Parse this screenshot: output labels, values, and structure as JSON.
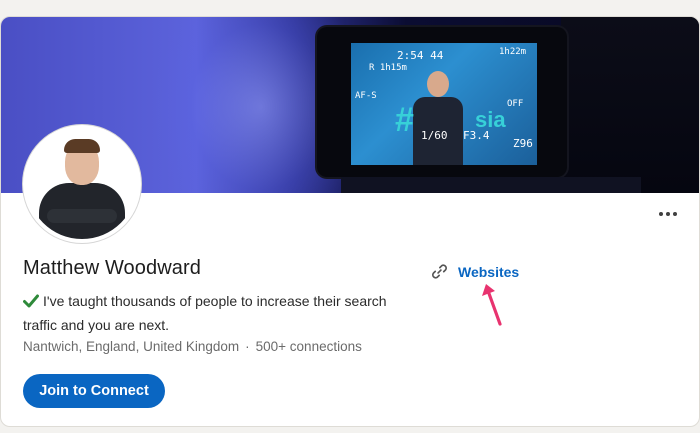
{
  "banner": {
    "hud": {
      "time": "2:54 44",
      "record_readout": "R 1h15m",
      "battery": "1h22m",
      "shutter": "1/60",
      "aperture": "F3.4",
      "iso": "Z96",
      "af_mode": "AF-S",
      "wb_off": "OFF"
    },
    "screen_text": {
      "hash": "#",
      "sia": "sia"
    }
  },
  "profile": {
    "name": "Matthew Woodward",
    "headline": "I've taught thousands of people to increase their search traffic and you are next.",
    "location": "Nantwich, England, United Kingdom",
    "separator": "·",
    "connections": "500+ connections",
    "join_button_label": "Join to Connect",
    "websites_label": "Websites"
  },
  "colors": {
    "linkedin_blue": "#0a66c2",
    "check_green": "#2e8a3a",
    "annotation_arrow": "#e8336f"
  },
  "icons": {
    "more": "more-horizontal-icon",
    "check": "check-icon",
    "link": "link-icon",
    "arrow": "annotation-arrow-icon"
  }
}
